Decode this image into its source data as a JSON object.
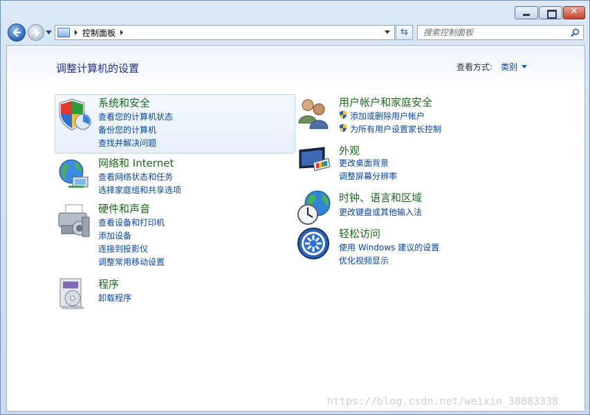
{
  "nav": {
    "breadcrumb": "控制面板",
    "search_placeholder": "搜索控制面板"
  },
  "header": {
    "title": "调整计算机的设置",
    "view_by_label": "查看方式:",
    "view_by_value": "类别"
  },
  "categories": [
    {
      "title": "系统和安全",
      "links": [
        "查看您的计算机状态",
        "备份您的计算机",
        "查找并解决问题"
      ],
      "icon": "shield-icon"
    },
    {
      "title": "网络和 Internet",
      "links": [
        "查看网络状态和任务",
        "选择家庭组和共享选项"
      ],
      "icon": "network-globe-icon"
    },
    {
      "title": "硬件和声音",
      "links": [
        "查看设备和打印机",
        "添加设备",
        "连接到投影仪",
        "调整常用移动设置"
      ],
      "icon": "printer-icon"
    },
    {
      "title": "程序",
      "links": [
        "卸载程序"
      ],
      "icon": "programs-icon"
    },
    {
      "title": "用户帐户和家庭安全",
      "links": [
        "添加或删除用户帐户",
        "为所有用户设置家长控制"
      ],
      "icon": "users-icon"
    },
    {
      "title": "外观",
      "links": [
        "更改桌面背景",
        "调整屏幕分辨率"
      ],
      "icon": "appearance-monitor-icon"
    },
    {
      "title": "时钟、语言和区域",
      "links": [
        "更改键盘或其他输入法"
      ],
      "icon": "clock-globe-icon"
    },
    {
      "title": "轻松访问",
      "links": [
        "使用 Windows 建议的设置",
        "优化视频显示"
      ],
      "icon": "ease-of-access-icon"
    }
  ],
  "watermark": "https://blog.csdn.net/weixin_38883338"
}
